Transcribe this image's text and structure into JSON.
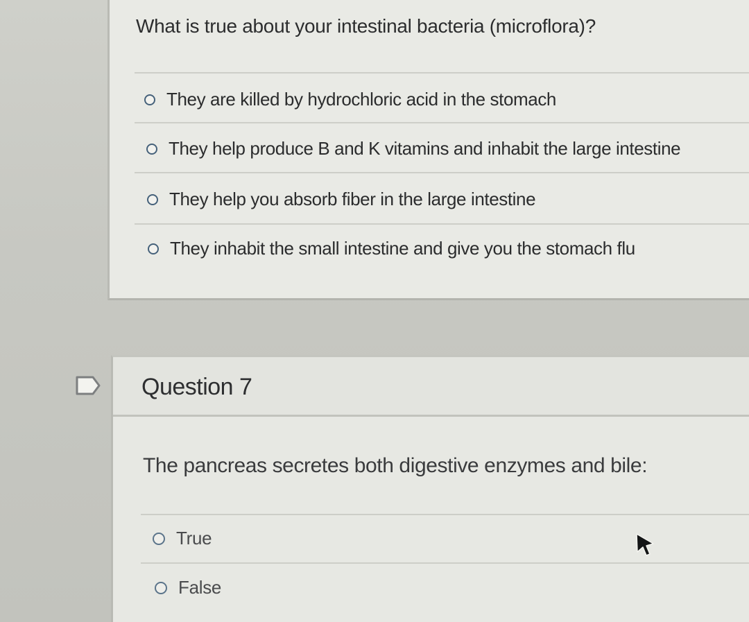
{
  "question6": {
    "prompt": "What is true about your intestinal bacteria (microflora)?",
    "answers": [
      {
        "label": "They are killed by hydrochloric acid in the stomach",
        "selected": false
      },
      {
        "label": "They help produce B and K vitamins and inhabit the large intestine",
        "selected": false
      },
      {
        "label": "They help you absorb fiber in the large intestine",
        "selected": false
      },
      {
        "label": "They inhabit the small intestine and give you the stomach flu",
        "selected": false
      }
    ]
  },
  "question7": {
    "title": "Question 7",
    "prompt": "The pancreas secretes both digestive enzymes and bile:",
    "answers": [
      {
        "label": "True",
        "selected": false
      },
      {
        "label": "False",
        "selected": false
      }
    ]
  },
  "icons": {
    "flag": "flag-outline-icon",
    "cursor": "mouse-pointer-icon"
  },
  "colors": {
    "radio_border": "#45617a",
    "card_background": "#e9eae5",
    "text": "#2c2d2e"
  }
}
